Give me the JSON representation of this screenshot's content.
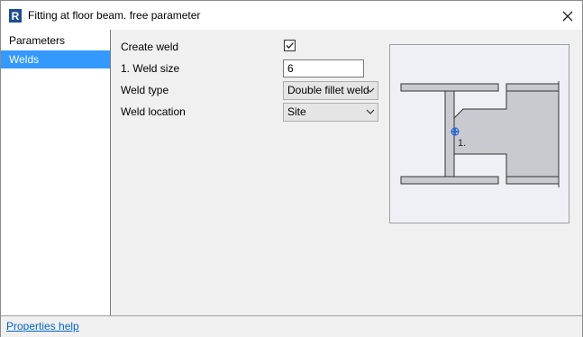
{
  "window": {
    "title": "Fitting at floor beam. free parameter",
    "icon": "revit-r-icon"
  },
  "sidebar": {
    "items": [
      {
        "label": "Parameters",
        "active": false
      },
      {
        "label": "Welds",
        "active": true
      }
    ]
  },
  "form": {
    "create_weld": {
      "label": "Create weld",
      "checked": true
    },
    "weld_size": {
      "label": "1. Weld size",
      "value": "6"
    },
    "weld_type": {
      "label": "Weld type",
      "value": "Double fillet weld"
    },
    "weld_location": {
      "label": "Weld location",
      "value": "Site"
    }
  },
  "preview": {
    "marker_label": "1."
  },
  "footer": {
    "help_link": "Properties help"
  },
  "colors": {
    "selection": "#3399ff",
    "link": "#0066cc",
    "panel": "#f0f0f0"
  }
}
